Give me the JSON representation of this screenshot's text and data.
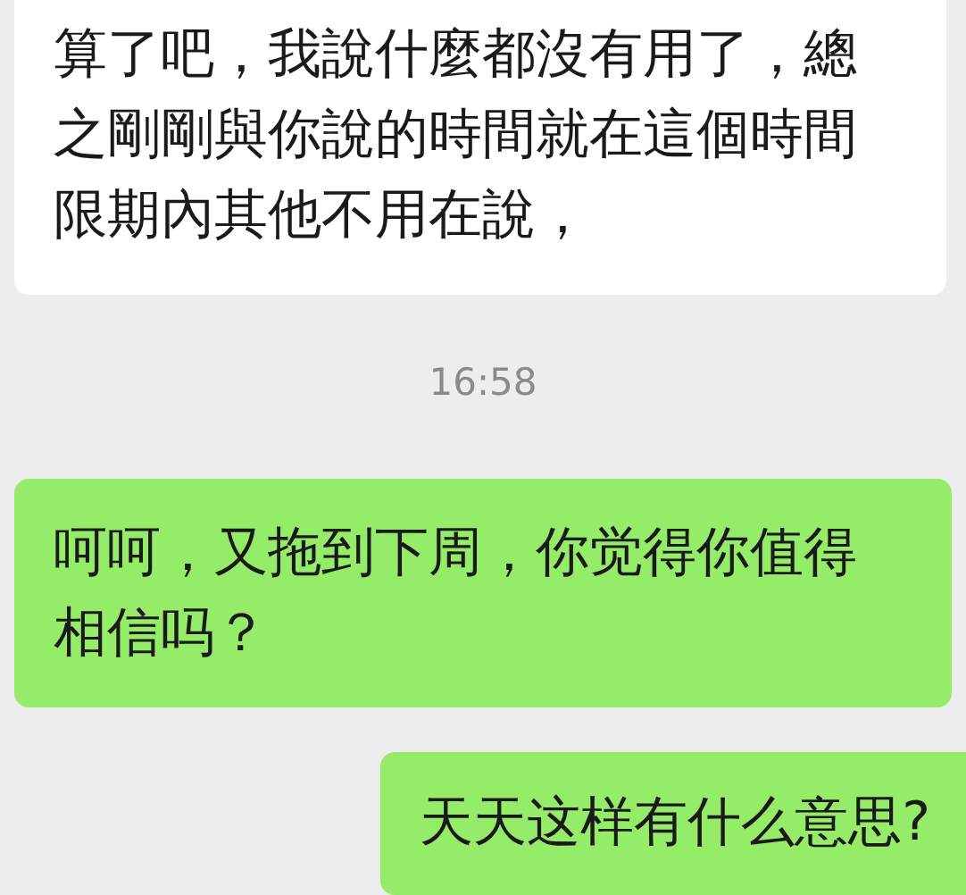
{
  "messages": [
    {
      "kind": "received",
      "text": "算了吧，我說什麼都沒有用了，總之剛剛與你說的時間就在這個時間限期內其他不用在說，"
    },
    {
      "kind": "time",
      "text": "16:58"
    },
    {
      "kind": "sent",
      "text": "呵呵，又拖到下周，你觉得你值得相信吗？"
    },
    {
      "kind": "sent",
      "text": "天天这样有什么意思?"
    }
  ]
}
